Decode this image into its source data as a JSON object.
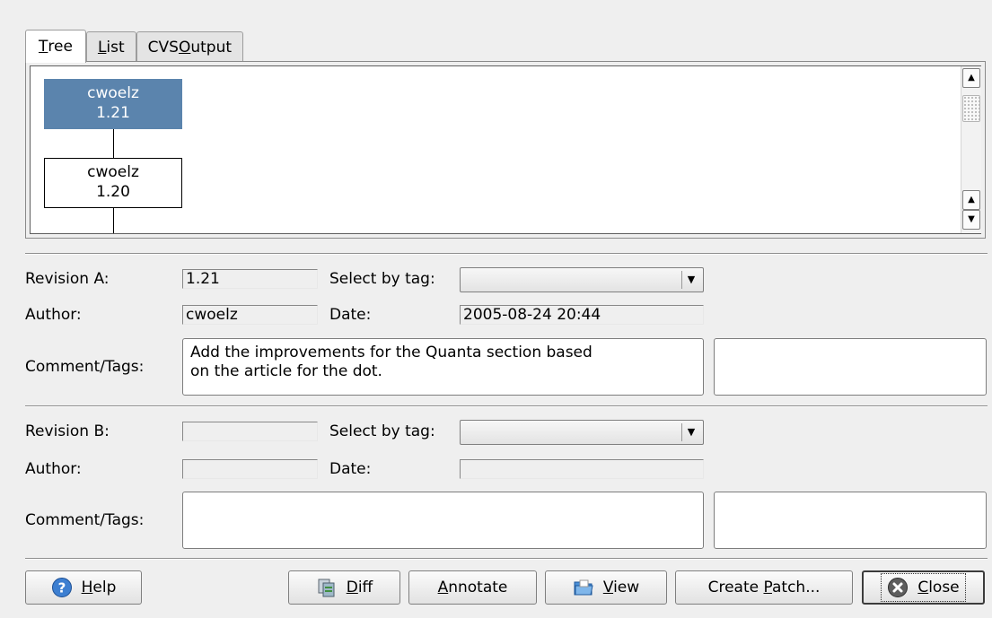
{
  "tabs": [
    {
      "label_pre": "",
      "label_key": "T",
      "label_post": "ree"
    },
    {
      "label_pre": "",
      "label_key": "L",
      "label_post": "ist"
    },
    {
      "label_pre": "CVS ",
      "label_key": "O",
      "label_post": "utput"
    }
  ],
  "tree": {
    "nodes": [
      {
        "author": "cwoelz",
        "revision": "1.21"
      },
      {
        "author": "cwoelz",
        "revision": "1.20"
      }
    ]
  },
  "revision_a": {
    "revision_label": "Revision A:",
    "revision_value": "1.21",
    "select_tag_label": "Select by tag:",
    "author_label": "Author:",
    "author_value": "cwoelz",
    "date_label": "Date:",
    "date_value": "2005-08-24 20:44",
    "comment_label": "Comment/Tags:",
    "comment_line1": "Add the improvements for the Quanta section based",
    "comment_line2": "on the article for the dot.",
    "tags_value": ""
  },
  "revision_b": {
    "revision_label": "Revision B:",
    "revision_value": "",
    "select_tag_label": "Select by tag:",
    "author_label": "Author:",
    "author_value": "",
    "date_label": "Date:",
    "date_value": "",
    "comment_label": "Comment/Tags:",
    "comment_value": "",
    "tags_value": ""
  },
  "buttons": {
    "help": {
      "pre": "",
      "key": "H",
      "post": "elp"
    },
    "diff": {
      "pre": "",
      "key": "D",
      "post": "iff"
    },
    "annotate": {
      "pre": "",
      "key": "A",
      "post": "nnotate"
    },
    "view": {
      "pre": "",
      "key": "V",
      "post": "iew"
    },
    "create_patch": {
      "pre": "Create ",
      "key": "P",
      "post": "atch..."
    },
    "close": {
      "pre": "",
      "key": "C",
      "post": "lose"
    }
  },
  "colors": {
    "selected_node": "#5b84ad",
    "window_bg": "#efefef"
  },
  "icons": [
    "help-icon",
    "diff-icon",
    "view-icon",
    "close-icon",
    "scroll-up-icon",
    "scroll-down-icon"
  ]
}
